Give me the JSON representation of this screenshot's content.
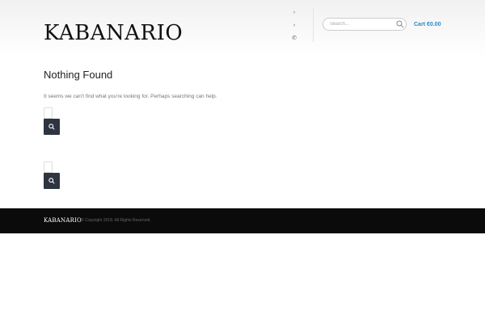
{
  "header": {
    "logo_text": "KABANARIO",
    "top_icons": [
      "chevron-right-icon",
      "chevron-right-icon",
      "phone-icon"
    ],
    "search": {
      "placeholder": "Search..."
    },
    "cart_label": "Cart €0.00"
  },
  "main": {
    "title": "Nothing Found",
    "message": "It seems we can't find what you're looking for. Perhaps searching can help."
  },
  "footer": {
    "logo_text": "KABANARIO",
    "copyright": "© Copyright 2018. All Rights Reserved."
  },
  "colors": {
    "accent": "#2a8ac9",
    "button": "#2e3440",
    "footer_bg": "#0b0b0b"
  }
}
